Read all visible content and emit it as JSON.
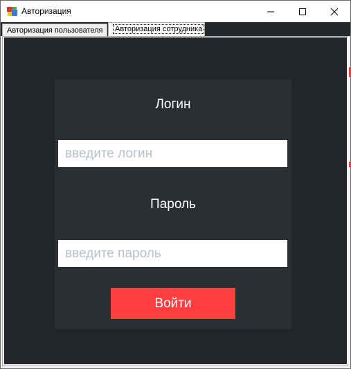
{
  "window": {
    "title": "Авторизация",
    "icon": "windows-form-icon",
    "controls": [
      "minimize-icon",
      "maximize-icon",
      "close-icon"
    ]
  },
  "tabs": [
    {
      "label": "Авторизация пользователя",
      "selected": false
    },
    {
      "label": "Авторизация сотрудника",
      "selected": true
    }
  ],
  "form": {
    "login_label": "Логин",
    "login_placeholder": "введите логин",
    "login_value": "",
    "password_label": "Пароль",
    "password_placeholder": "введите пароль",
    "password_value": "",
    "submit_label": "Войти"
  },
  "colors": {
    "background": "#22252a",
    "panel": "#2b2e33",
    "accent": "#ff3f3f",
    "placeholder": "#b8c0cb",
    "text": "#ffffff"
  }
}
